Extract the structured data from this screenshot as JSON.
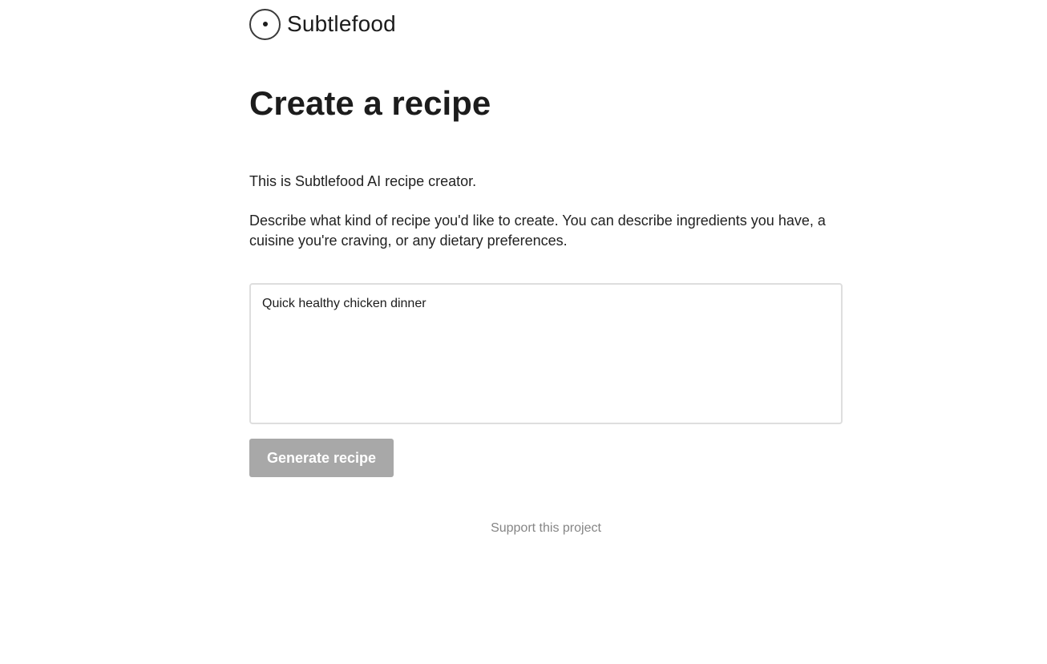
{
  "header": {
    "brand": "Subtlefood",
    "logo_icon": "circle-dot-icon"
  },
  "main": {
    "title": "Create a recipe",
    "intro": "This is Subtlefood AI recipe creator.",
    "description": "Describe what kind of recipe you'd like to create. You can describe ingredients you have, a cuisine you're craving, or any dietary preferences.",
    "prompt": {
      "value": "Quick healthy chicken dinner"
    },
    "generate_label": "Generate recipe"
  },
  "footer": {
    "support_label": "Support this project"
  },
  "colors": {
    "button_disabled": "#a8a8a8",
    "text": "#1c1c1c",
    "muted_link": "#858585",
    "border": "#dedede"
  }
}
